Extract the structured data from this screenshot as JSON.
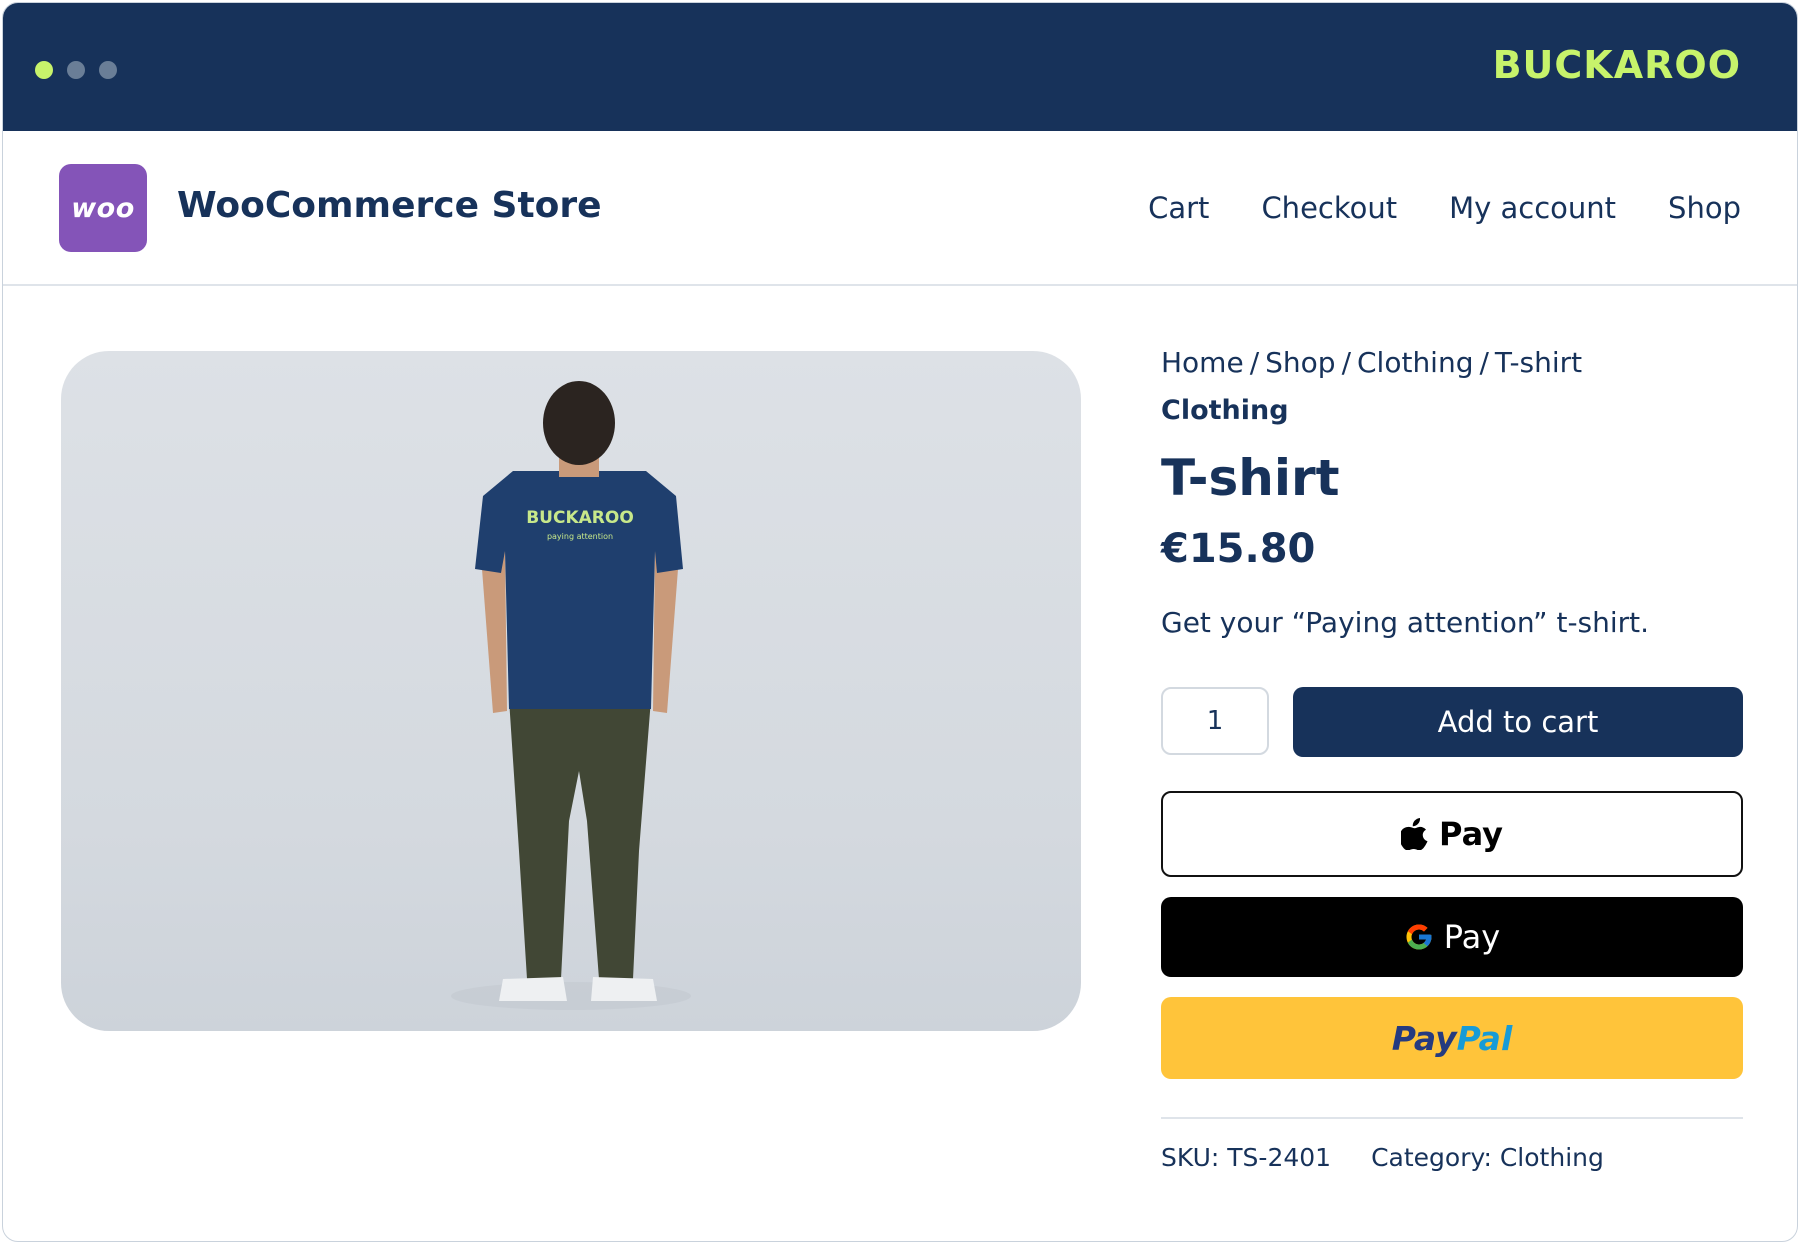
{
  "window": {
    "brand": "BUCKAROO"
  },
  "header": {
    "logo_text": "woo",
    "store_name": "WooCommerce Store",
    "nav": [
      "Cart",
      "Checkout",
      "My account",
      "Shop"
    ]
  },
  "product": {
    "breadcrumb": [
      "Home",
      "Shop",
      "Clothing",
      "T-shirt"
    ],
    "category": "Clothing",
    "title": "T-shirt",
    "price": "€15.80",
    "description": "Get your “Paying attention” t-shirt.",
    "quantity": "1",
    "add_to_cart": "Add to cart",
    "shirt_print": "BUCKAROO",
    "shirt_tagline": "paying attention"
  },
  "payments": {
    "apple_pay": "Pay",
    "google_pay": "Pay",
    "paypal_a": "Pay",
    "paypal_b": "Pal"
  },
  "meta": {
    "sku_label": "SKU:",
    "sku": "TS-2401",
    "category_label": "Category:",
    "category": "Clothing"
  },
  "colors": {
    "navy": "#17325a",
    "lime": "#c7f36b",
    "woo_purple": "#8454b8",
    "paypal_yellow": "#ffc43a"
  },
  "icons": [
    "apple-icon",
    "google-g-icon"
  ]
}
